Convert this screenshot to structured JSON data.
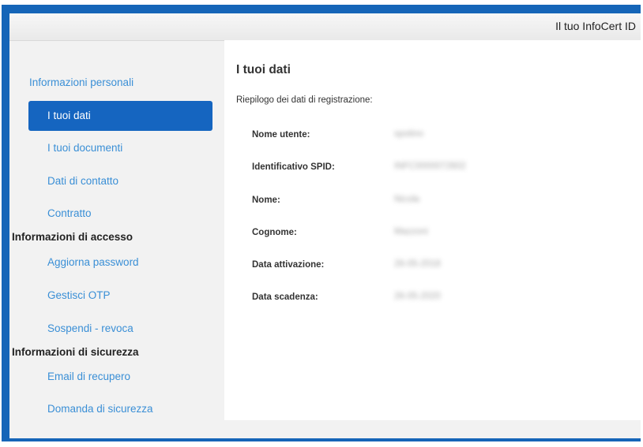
{
  "header": {
    "title": "Il tuo InfoCert ID"
  },
  "sidebar": {
    "section_personal": "Informazioni personali",
    "items_personal": [
      {
        "label": "I tuoi dati",
        "active": true
      },
      {
        "label": "I tuoi documenti"
      },
      {
        "label": "Dati di contatto"
      },
      {
        "label": "Contratto"
      }
    ],
    "section_access": "Informazioni di accesso",
    "items_access": [
      {
        "label": "Aggiorna password"
      },
      {
        "label": "Gestisci OTP"
      },
      {
        "label": "Sospendi - revoca"
      }
    ],
    "section_security": "Informazioni di sicurezza",
    "items_security": [
      {
        "label": "Email di recupero"
      },
      {
        "label": "Domanda di sicurezza"
      }
    ]
  },
  "main": {
    "title": "I tuoi dati",
    "subtitle": "Riepilogo dei dati di registrazione:",
    "fields": [
      {
        "label": "Nome utente:",
        "value": "spotino"
      },
      {
        "label": "Identificativo SPID:",
        "value": "INFC0000072602"
      },
      {
        "label": "Nome:",
        "value": "Nicola"
      },
      {
        "label": "Cognome:",
        "value": "Mazzoni"
      },
      {
        "label": "Data attivazione:",
        "value": "26-05-2018"
      },
      {
        "label": "Data scadenza:",
        "value": "26-05-2020"
      }
    ]
  }
}
